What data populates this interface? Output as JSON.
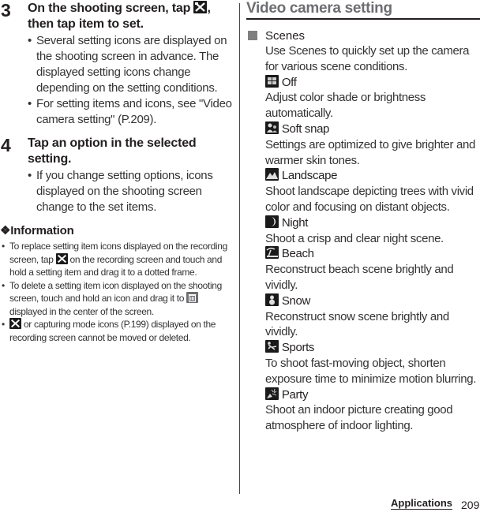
{
  "steps": [
    {
      "number": "3",
      "title_part1": "On the shooting screen, tap ",
      "title_icon": "settings-tools-icon",
      "title_part2": ",",
      "title_line2": "then tap item to set.",
      "bullets": [
        "Several setting icons are displayed on the shooting screen in advance. The displayed setting icons change depending on the setting conditions.",
        "For setting items and icons, see \"Video camera setting\" (P.209)."
      ]
    },
    {
      "number": "4",
      "title": "Tap an option in the selected setting.",
      "bullets": [
        "If you change setting options, icons displayed on the shooting screen change to the set items."
      ]
    }
  ],
  "information": {
    "symbol": "❖",
    "title": "Information",
    "items": [
      {
        "before": "To replace setting item icons displayed on the recording screen, tap ",
        "icon": "settings-tools-icon",
        "after": " on the recording screen and touch and hold a setting item and drag it to a dotted frame."
      },
      {
        "before": "To delete a setting item icon displayed on the shooting screen, touch and hold an icon and drag it to ",
        "icon": "trash-icon",
        "after": " displayed in the center of the screen."
      },
      {
        "before": "",
        "icon": "settings-tools-icon",
        "after": " or capturing mode icons (P.199) displayed on the recording screen cannot be moved or deleted."
      }
    ]
  },
  "section": {
    "title": "Video camera setting",
    "heading": "Scenes",
    "description": "Use Scenes to quickly set up the camera for various scene conditions.",
    "options": [
      {
        "icon": "scene-off-icon",
        "label": "Off",
        "description": "Adjust color shade or brightness automatically."
      },
      {
        "icon": "soft-snap-icon",
        "label": "Soft snap",
        "description": "Settings are optimized to give brighter and warmer skin tones."
      },
      {
        "icon": "landscape-icon",
        "label": "Landscape",
        "description": "Shoot landscape depicting trees with vivid color and focusing on distant objects."
      },
      {
        "icon": "night-icon",
        "label": "Night",
        "description": "Shoot a crisp and clear night scene."
      },
      {
        "icon": "beach-icon",
        "label": "Beach",
        "description": "Reconstruct beach scene brightly and vividly."
      },
      {
        "icon": "snow-icon",
        "label": "Snow",
        "description": "Reconstruct snow scene brightly and vividly."
      },
      {
        "icon": "sports-icon",
        "label": "Sports",
        "description": "To shoot fast-moving object, shorten exposure time to minimize motion blurring."
      },
      {
        "icon": "party-icon",
        "label": "Party",
        "description": "Shoot an indoor picture creating good atmosphere of indoor lighting."
      }
    ]
  },
  "footer": {
    "section_label": "Applications",
    "page_number": "209"
  }
}
